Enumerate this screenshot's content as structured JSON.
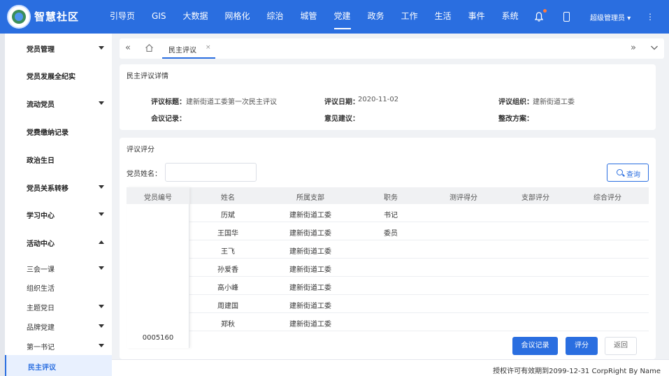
{
  "brand": {
    "name": "智慧社区"
  },
  "nav": {
    "items": [
      "引导页",
      "GIS",
      "大数据",
      "网格化",
      "综治",
      "城管",
      "党建",
      "政务",
      "工作",
      "生活",
      "事件",
      "系统"
    ],
    "active_index": 6
  },
  "header": {
    "user": "超级管理员",
    "notification_dot_color": "#ff7a3d"
  },
  "sidebar": {
    "items": [
      {
        "label": "党员管理",
        "caret": "down"
      },
      {
        "label": "党员发展全纪实",
        "caret": ""
      },
      {
        "label": "流动党员",
        "caret": "down"
      },
      {
        "label": "党费缴纳记录",
        "caret": ""
      },
      {
        "label": "政治生日",
        "caret": ""
      },
      {
        "label": "党员关系转移",
        "caret": "down"
      },
      {
        "label": "学习中心",
        "caret": "down"
      },
      {
        "label": "活动中心",
        "caret": "up"
      }
    ],
    "sub_items": [
      {
        "label": "三会一课",
        "caret": "down"
      },
      {
        "label": "组织生活",
        "caret": ""
      },
      {
        "label": "主题党日",
        "caret": "down"
      },
      {
        "label": "品牌党建",
        "caret": "down"
      },
      {
        "label": "第一书记",
        "caret": "down"
      }
    ],
    "active_item": "民主评议"
  },
  "tabs": {
    "active": "民主评议",
    "close_glyph": "×"
  },
  "detail": {
    "title": "民主评议详情",
    "fields": {
      "topic_label": "评议标题：",
      "topic_value": "建新街道工委第一次民主评议",
      "date_label": "评议日期：",
      "date_value": "2020-11-02",
      "org_label": "评议组织：",
      "org_value": "建新街道工委",
      "record_label": "会议记录：",
      "suggest_label": "意见建议：",
      "plan_label": "整改方案："
    }
  },
  "scoring": {
    "title": "评议评分",
    "filter_label": "党员姓名：",
    "name_value": "",
    "query_button": "查询",
    "columns": [
      "党员编号",
      "姓名",
      "所属支部",
      "职务",
      "测评得分",
      "支部评分",
      "综合评分"
    ],
    "rows": [
      {
        "id": "",
        "name": "历斌",
        "branch": "建新街道工委",
        "post": "书记",
        "test_score": "",
        "branch_score": "",
        "total_score": ""
      },
      {
        "id": "",
        "name": "王国华",
        "branch": "建新街道工委",
        "post": "委员",
        "test_score": "",
        "branch_score": "",
        "total_score": ""
      },
      {
        "id": "",
        "name": "王飞",
        "branch": "建新街道工委",
        "post": "",
        "test_score": "",
        "branch_score": "",
        "total_score": ""
      },
      {
        "id": "",
        "name": "孙爱香",
        "branch": "建新街道工委",
        "post": "",
        "test_score": "",
        "branch_score": "",
        "total_score": ""
      },
      {
        "id": "",
        "name": "高小峰",
        "branch": "建新街道工委",
        "post": "",
        "test_score": "",
        "branch_score": "",
        "total_score": ""
      },
      {
        "id": "",
        "name": "周建国",
        "branch": "建新街道工委",
        "post": "",
        "test_score": "",
        "branch_score": "",
        "total_score": ""
      },
      {
        "id": "",
        "name": "郑秋",
        "branch": "建新街道工委",
        "post": "",
        "test_score": "",
        "branch_score": "",
        "total_score": ""
      }
    ],
    "fixed_id_value": "0005160",
    "buttons": {
      "meeting_record": "会议记录",
      "score": "评分",
      "back": "返回"
    }
  },
  "footer": {
    "text": "授权许可有效期到2099-12-31 CorpRight By Name"
  },
  "colors": {
    "primary": "#2a6ee0",
    "page_bg": "#f0f2f5"
  }
}
